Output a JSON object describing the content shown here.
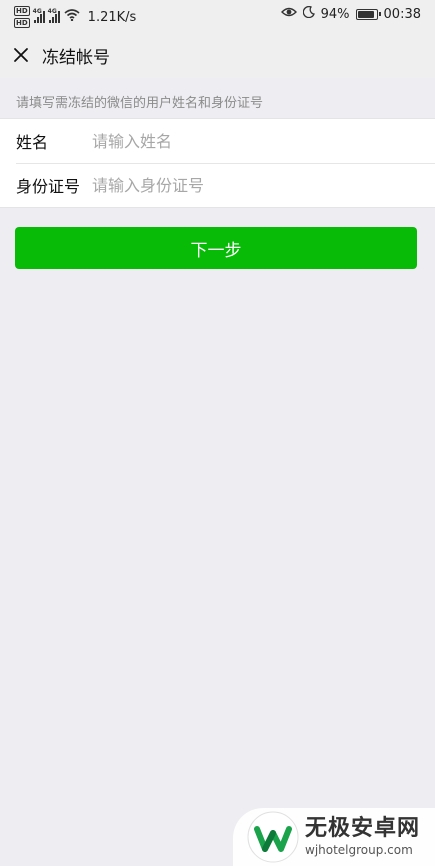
{
  "status_bar": {
    "net_speed": "1.21K/s",
    "network_labels": [
      "4G",
      "4G"
    ],
    "battery_percent": "94%",
    "battery_level": 0.94,
    "time": "00:38",
    "icons": [
      "hd-icon",
      "signal-icon",
      "wifi-icon",
      "eye-icon",
      "moon-icon",
      "battery-icon"
    ]
  },
  "header": {
    "title": "冻结帐号",
    "close_icon": "close-icon"
  },
  "hint": "请填写需冻结的微信的用户姓名和身份证号",
  "form": {
    "name": {
      "label": "姓名",
      "placeholder": "请输入姓名",
      "value": ""
    },
    "id_number": {
      "label": "身份证号",
      "placeholder": "请输入身份证号",
      "value": ""
    }
  },
  "next_button": {
    "label": "下一步",
    "color": "#08bb07"
  },
  "watermark": {
    "name": "无极安卓网",
    "url": "wjhotelgroup.com"
  }
}
